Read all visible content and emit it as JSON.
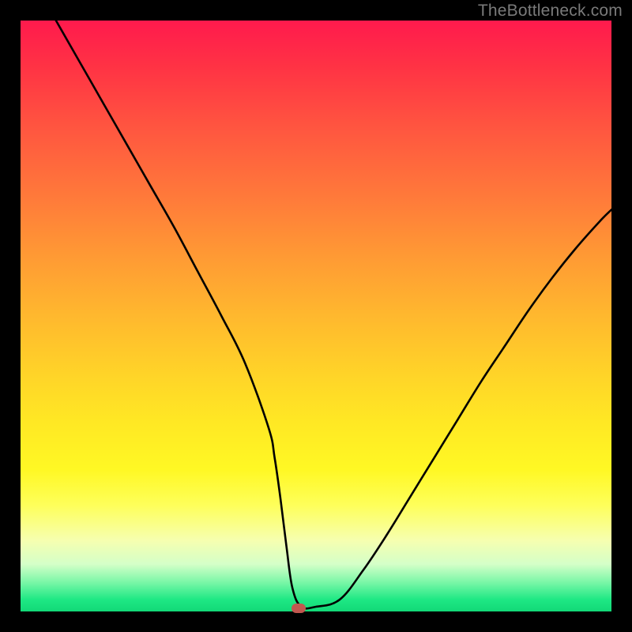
{
  "watermark": "TheBottleneck.com",
  "chart_data": {
    "type": "line",
    "title": "",
    "xlabel": "",
    "ylabel": "",
    "xlim": [
      0,
      100
    ],
    "ylim": [
      0,
      100
    ],
    "grid": false,
    "legend": false,
    "series": [
      {
        "name": "bottleneck-curve",
        "x": [
          6,
          10,
          14,
          18,
          22,
          26,
          30,
          34,
          38,
          42,
          43,
          44,
          45,
          46,
          47.5,
          50,
          54,
          58,
          62,
          66,
          70,
          74,
          78,
          82,
          86,
          90,
          94,
          98,
          100
        ],
        "y": [
          100,
          93,
          86,
          79,
          72,
          65,
          57.5,
          50,
          42,
          31,
          26,
          19,
          11,
          4,
          0.8,
          0.8,
          2,
          7,
          13,
          19.5,
          26,
          32.5,
          39,
          45,
          51,
          56.5,
          61.5,
          66,
          68
        ]
      }
    ],
    "marker": {
      "x": 47,
      "y": 0.6
    },
    "gradient_stops": [
      {
        "pos": 0,
        "color": "#ff1a4d"
      },
      {
        "pos": 50,
        "color": "#ffb82e"
      },
      {
        "pos": 80,
        "color": "#fff824"
      },
      {
        "pos": 100,
        "color": "#12d877"
      }
    ]
  }
}
